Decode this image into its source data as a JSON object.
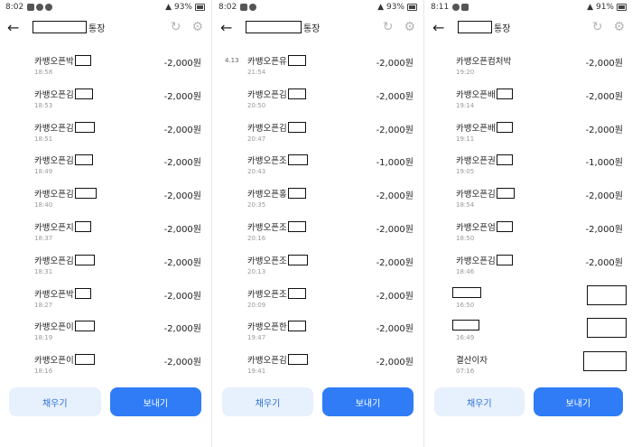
{
  "panels": [
    {
      "status_time": "8:02",
      "battery": "93%",
      "account_suffix": "통장",
      "rows": [
        {
          "date": "",
          "title": "카뱅오픈박",
          "time": "18:58",
          "amount": "-2,000원"
        },
        {
          "date": "",
          "title": "카뱅오픈김",
          "time": "18:53",
          "amount": "-2,000원"
        },
        {
          "date": "",
          "title": "카뱅오픈김",
          "time": "18:51",
          "amount": "-2,000원"
        },
        {
          "date": "",
          "title": "카뱅오픈김",
          "time": "18:49",
          "amount": "-2,000원"
        },
        {
          "date": "",
          "title": "카뱅오픈김",
          "time": "18:40",
          "amount": "-2,000원"
        },
        {
          "date": "",
          "title": "카뱅오픈지",
          "time": "18:37",
          "amount": "-2,000원"
        },
        {
          "date": "",
          "title": "카뱅오픈김",
          "time": "18:31",
          "amount": "-2,000원"
        },
        {
          "date": "",
          "title": "카뱅오픈박",
          "time": "18:27",
          "amount": "-2,000원"
        },
        {
          "date": "",
          "title": "카뱅오픈이",
          "time": "18:19",
          "amount": "-2,000원"
        },
        {
          "date": "",
          "title": "카뱅오픈이",
          "time": "18:16",
          "amount": "-2,000원"
        }
      ],
      "fill_label": "채우기",
      "send_label": "보내기"
    },
    {
      "status_time": "8:02",
      "battery": "93%",
      "account_suffix": "통장",
      "rows": [
        {
          "date": "4.13",
          "title": "카뱅오픈유",
          "time": "21:54",
          "amount": "-2,000원"
        },
        {
          "date": "",
          "title": "카뱅오픈김",
          "time": "20:50",
          "amount": "-2,000원"
        },
        {
          "date": "",
          "title": "카뱅오픈김",
          "time": "20:47",
          "amount": "-2,000원"
        },
        {
          "date": "",
          "title": "카뱅오픈조",
          "time": "20:43",
          "amount": "-1,000원"
        },
        {
          "date": "",
          "title": "카뱅오픈홍",
          "time": "20:35",
          "amount": "-2,000원"
        },
        {
          "date": "",
          "title": "카뱅오픈조",
          "time": "20:16",
          "amount": "-2,000원"
        },
        {
          "date": "",
          "title": "카뱅오픈조",
          "time": "20:13",
          "amount": "-2,000원"
        },
        {
          "date": "",
          "title": "카뱅오픈조",
          "time": "20:09",
          "amount": "-2,000원"
        },
        {
          "date": "",
          "title": "카뱅오픈한",
          "time": "19:47",
          "amount": "-2,000원"
        },
        {
          "date": "",
          "title": "카뱅오픈김",
          "time": "19:41",
          "amount": "-2,000원"
        }
      ],
      "fill_label": "채우기",
      "send_label": "보내기"
    },
    {
      "status_time": "8:11",
      "battery": "91%",
      "account_suffix": "통장",
      "rows": [
        {
          "date": "",
          "title": "카뱅오픈컴처박",
          "time": "19:20",
          "amount": "-2,000원"
        },
        {
          "date": "",
          "title": "카뱅오픈배",
          "time": "19:14",
          "amount": "-2,000원"
        },
        {
          "date": "",
          "title": "카뱅오픈배",
          "time": "19:11",
          "amount": "-2,000원"
        },
        {
          "date": "",
          "title": "카뱅오픈권",
          "time": "19:05",
          "amount": "-1,000원"
        },
        {
          "date": "",
          "title": "카뱅오픈김",
          "time": "18:54",
          "amount": "-2,000원"
        },
        {
          "date": "",
          "title": "카뱅오픈엄",
          "time": "18:50",
          "amount": "-2,000원"
        },
        {
          "date": "",
          "title": "카뱅오픈김",
          "time": "18:46",
          "amount": "-2,000원"
        },
        {
          "date": "",
          "title": "",
          "time": "16:50",
          "amount": ""
        },
        {
          "date": "",
          "title": "",
          "time": "16:49",
          "amount": ""
        },
        {
          "date": "",
          "title": "결산이자",
          "time": "07:16",
          "amount": ""
        }
      ],
      "fill_label": "채우기",
      "send_label": "보내기"
    }
  ],
  "icons": {
    "back": "arrow-left-icon",
    "refresh": "refresh-icon",
    "settings": "gear-icon"
  }
}
